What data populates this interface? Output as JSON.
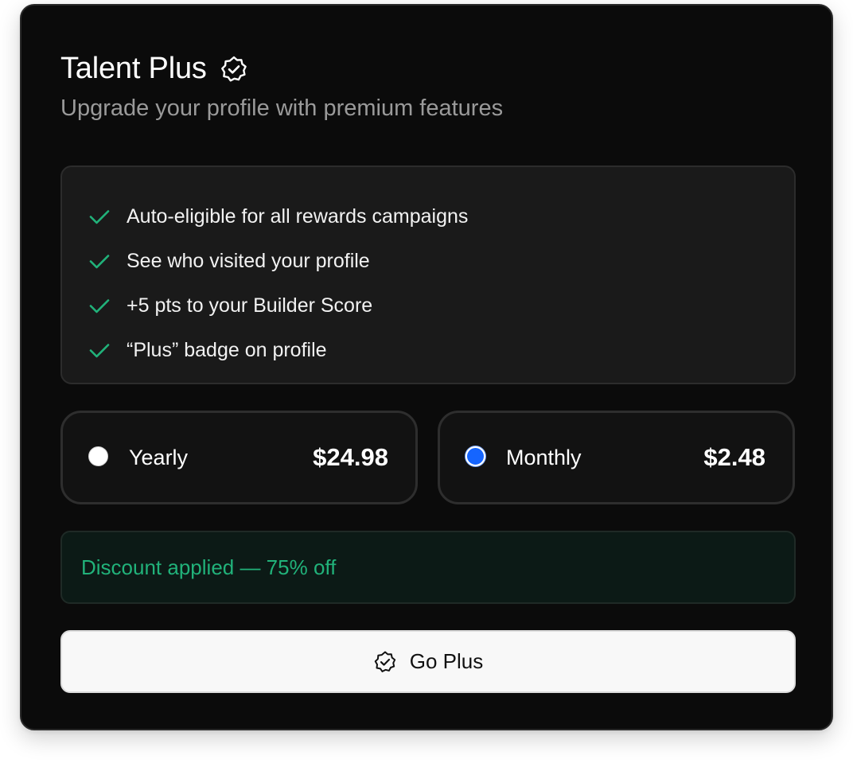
{
  "header": {
    "title": "Talent Plus",
    "title_icon": "verified-badge-icon",
    "subtitle": "Upgrade your profile with premium features"
  },
  "features": {
    "icon": "check-icon",
    "items": [
      {
        "label": "Auto-eligible for all rewards campaigns"
      },
      {
        "label": "See who visited your profile"
      },
      {
        "label": "+5 pts to your Builder Score"
      },
      {
        "label": "“Plus” badge on profile"
      }
    ]
  },
  "plans": {
    "yearly": {
      "label": "Yearly",
      "price": "$24.98",
      "selected": false
    },
    "monthly": {
      "label": "Monthly",
      "price": "$2.48",
      "selected": true
    }
  },
  "discount": {
    "text": "Discount applied — 75% off"
  },
  "cta": {
    "label": "Go Plus",
    "icon": "verified-badge-icon"
  },
  "colors": {
    "card_background": "#0b0b0b",
    "check": "#21b27a",
    "discount_text": "#21b27a",
    "radio_selected": "#1565ff",
    "button_background": "#f8f8f8"
  }
}
